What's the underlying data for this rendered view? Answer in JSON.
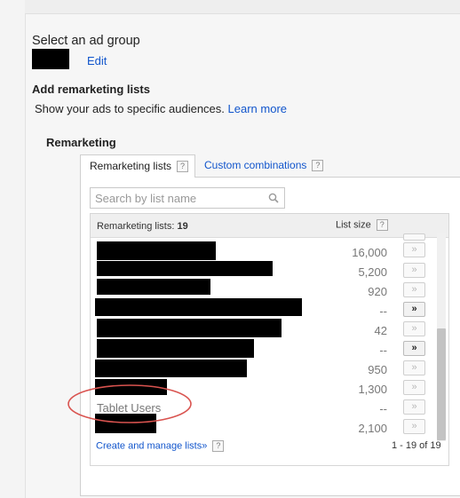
{
  "header": {
    "select_group_title": "Select an ad group",
    "edit_link": "Edit",
    "add_lists_heading": "Add remarketing lists",
    "subtitle": "Show your ads to specific audiences.",
    "learn_more": "Learn more",
    "section_title": "Remarketing"
  },
  "tabs": [
    {
      "label": "Remarketing lists",
      "help": "?",
      "active": true
    },
    {
      "label": "Custom combinations",
      "help": "?",
      "active": false
    }
  ],
  "search": {
    "placeholder": "Search by list name"
  },
  "list": {
    "header_label": "Remarketing lists:",
    "count": "19",
    "size_header": "List size",
    "size_help": "?",
    "add_symbol": "»",
    "rows": [
      {
        "name": "",
        "size": "16,000",
        "add_enabled": false
      },
      {
        "name": "",
        "size": "5,200",
        "add_enabled": false
      },
      {
        "name": "",
        "size": "920",
        "add_enabled": false
      },
      {
        "name": "",
        "size": "--",
        "add_enabled": true
      },
      {
        "name": "",
        "size": "42",
        "add_enabled": false
      },
      {
        "name": "",
        "size": "--",
        "add_enabled": true
      },
      {
        "name": "",
        "size": "950",
        "add_enabled": false
      },
      {
        "name": "",
        "size": "1,300",
        "add_enabled": false
      },
      {
        "name": "Tablet Users",
        "size": "--",
        "add_enabled": false
      },
      {
        "name": "",
        "size": "2,100",
        "add_enabled": false
      }
    ]
  },
  "footer": {
    "manage_link": "Create and manage lists»",
    "help": "?",
    "pagination": "1 - 19 of 19"
  },
  "colors": {
    "link": "#1155cc",
    "annotation_circle": "#d9534f"
  }
}
